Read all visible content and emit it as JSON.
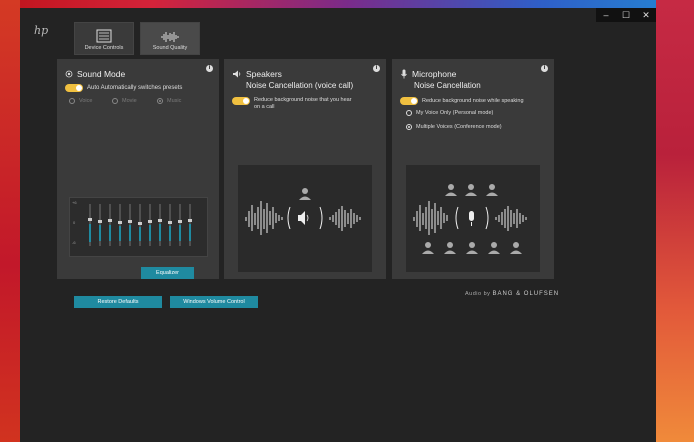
{
  "window": {
    "controls": {
      "minimize": "–",
      "maximize": "☐",
      "close": "✕"
    },
    "logo": "hp"
  },
  "nav": {
    "tabs": [
      {
        "label": "Device Controls"
      },
      {
        "label": "Sound Quality"
      }
    ]
  },
  "sound_mode": {
    "title": "Sound Mode",
    "auto_label": "Auto  Automatically switches presets",
    "options": [
      {
        "label": "Voice"
      },
      {
        "label": "Movie"
      },
      {
        "label": "Music"
      }
    ],
    "eq_ticks": [
      "+6",
      "0",
      "-6"
    ],
    "equalizer_button": "Equalizer"
  },
  "speakers": {
    "title": "Speakers",
    "subtitle": "Noise Cancellation (voice call)",
    "toggle_text_1": "Reduce background noise that you hear",
    "toggle_text_2": "on a call"
  },
  "microphone": {
    "title": "Microphone",
    "subtitle": "Noise Cancellation",
    "toggle_text": "Reduce background noise while speaking",
    "options": [
      {
        "label": "My Voice Only (Personal mode)",
        "selected": false
      },
      {
        "label": "Multiple Voices (Conference mode)",
        "selected": true
      }
    ]
  },
  "footer": {
    "restore_button": "Restore Defaults",
    "volume_button": "Windows Volume Control",
    "audio_by": "Audio by",
    "brand": "BANG & OLUFSEN"
  },
  "colors": {
    "accent": "#1f8aa0",
    "toggle": "#f0c040",
    "panel": "#3a3a3a",
    "window": "#232323"
  }
}
